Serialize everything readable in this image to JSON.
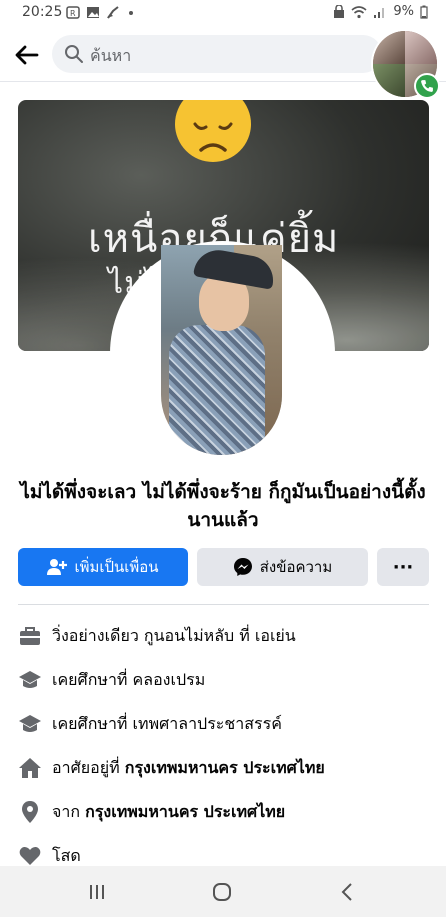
{
  "status_bar": {
    "time": "20:25",
    "battery": "9%"
  },
  "header": {
    "search_placeholder": "ค้นหา"
  },
  "cover": {
    "line1": "เหนื่อยก็แค่ยิ้ม",
    "line2": "ไม่ไ                    บ"
  },
  "profile": {
    "name": "ไม่ได้พึ่งจะเลว ไม่ได้พึ่งจะร้าย ก็กูมันเป็นอย่างนี้ตั้งนานแล้ว"
  },
  "actions": {
    "add_friend": "เพิ่มเป็นเพื่อน",
    "message": "ส่งข้อความ",
    "more": "···"
  },
  "details": {
    "work": "วิ่งอย่างเดียว กูนอนไม่หลับ ที่ เอเย่น",
    "edu1": "เคยศึกษาที่ คลองเปรม",
    "edu2": "เคยศึกษาที่ เทพศาลาประชาสรรค์",
    "lives_prefix": "อาศัยอยู่ที่ ",
    "lives_place": "กรุงเทพมหานคร ประเทศไทย",
    "from_prefix": "จาก ",
    "from_place": "กรุงเทพมหานคร ประเทศไทย",
    "relationship": "โสด"
  },
  "colors": {
    "primary": "#1877f2",
    "button_grey": "#e4e6eb",
    "call_green": "#31a24c",
    "icon_grey": "#65676b"
  },
  "icons": {
    "back": "arrow-left-icon",
    "search": "search-icon",
    "add_friend": "user-plus-icon",
    "messenger": "messenger-icon",
    "work": "briefcase-icon",
    "education": "graduation-cap-icon",
    "home": "home-icon",
    "location": "location-pin-icon",
    "relationship": "heart-icon"
  }
}
